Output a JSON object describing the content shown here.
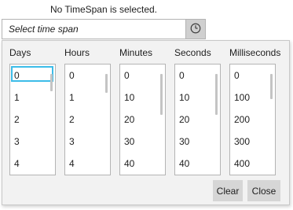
{
  "status_text": "No TimeSpan is selected.",
  "time_input": {
    "placeholder": "Select time span",
    "value": ""
  },
  "clock_button_icon": "clock-icon",
  "columns": [
    {
      "label": "Days",
      "items": [
        "0",
        "1",
        "2",
        "3",
        "4"
      ],
      "selected": "0"
    },
    {
      "label": "Hours",
      "items": [
        "0",
        "1",
        "2",
        "3",
        "4"
      ],
      "selected": null
    },
    {
      "label": "Minutes",
      "items": [
        "0",
        "10",
        "20",
        "30",
        "40"
      ],
      "selected": null
    },
    {
      "label": "Seconds",
      "items": [
        "0",
        "10",
        "20",
        "30",
        "40"
      ],
      "selected": null
    },
    {
      "label": "Milliseconds",
      "items": [
        "0",
        "100",
        "200",
        "300",
        "400"
      ],
      "selected": null
    }
  ],
  "buttons": {
    "clear": "Clear",
    "close": "Close"
  },
  "colors": {
    "selection_border": "#3dbce8",
    "button_bg": "#d6d6d6",
    "popup_bg": "#f2f2f2"
  }
}
